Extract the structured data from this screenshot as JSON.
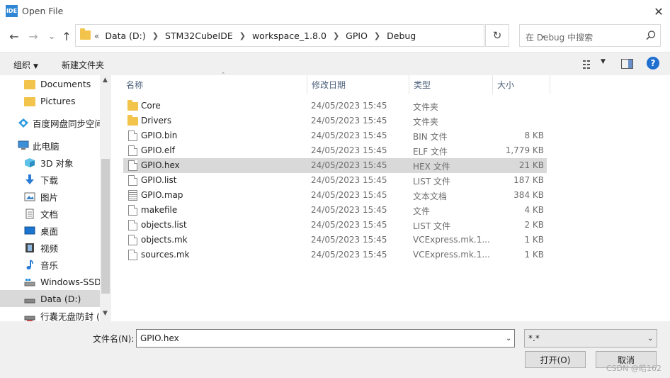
{
  "window": {
    "app_icon": "IDE",
    "title": "Open File",
    "close": "✕"
  },
  "nav": {
    "back": "←",
    "forward": "→",
    "recent": "⌄",
    "up": "↑",
    "breadcrumb": [
      "Data (D:)",
      "STM32CubeIDE",
      "workspace_1.8.0",
      "GPIO",
      "Debug"
    ],
    "overflow": "«",
    "refresh": "↻",
    "search_placeholder": "在 Debug 中搜索"
  },
  "toolbar": {
    "organize": "组织",
    "new_folder": "新建文件夹",
    "help": "?"
  },
  "sidebar": {
    "items": [
      {
        "label": "Documents",
        "icon": "folder-icon"
      },
      {
        "label": "Pictures",
        "icon": "folder-icon"
      },
      {
        "label": "百度网盘同步空间",
        "icon": "baidu-cloud-icon"
      },
      {
        "label": "此电脑",
        "icon": "computer-icon"
      },
      {
        "label": "3D 对象",
        "icon": "cube-3d-icon"
      },
      {
        "label": "下载",
        "icon": "download-icon"
      },
      {
        "label": "图片",
        "icon": "pictures-icon"
      },
      {
        "label": "文档",
        "icon": "documents-icon"
      },
      {
        "label": "桌面",
        "icon": "desktop-icon"
      },
      {
        "label": "视频",
        "icon": "video-icon"
      },
      {
        "label": "音乐",
        "icon": "music-icon"
      },
      {
        "label": "Windows-SSD",
        "icon": "drive-icon"
      },
      {
        "label": "Data (D:)",
        "icon": "drive-icon",
        "selected": true
      },
      {
        "label": "行囊无盘防封 (X",
        "icon": "drive-icon"
      }
    ]
  },
  "columns": {
    "name": "名称",
    "date": "修改日期",
    "type": "类型",
    "size": "大小"
  },
  "files": [
    {
      "name": "Core",
      "date": "24/05/2023 15:45",
      "type": "文件夹",
      "size": "",
      "icon": "folder"
    },
    {
      "name": "Drivers",
      "date": "24/05/2023 15:45",
      "type": "文件夹",
      "size": "",
      "icon": "folder"
    },
    {
      "name": "GPIO.bin",
      "date": "24/05/2023 15:45",
      "type": "BIN 文件",
      "size": "8 KB",
      "icon": "doc"
    },
    {
      "name": "GPIO.elf",
      "date": "24/05/2023 15:45",
      "type": "ELF 文件",
      "size": "1,779 KB",
      "icon": "doc"
    },
    {
      "name": "GPIO.hex",
      "date": "24/05/2023 15:45",
      "type": "HEX 文件",
      "size": "21 KB",
      "icon": "doc",
      "selected": true
    },
    {
      "name": "GPIO.list",
      "date": "24/05/2023 15:45",
      "type": "LIST 文件",
      "size": "187 KB",
      "icon": "doc"
    },
    {
      "name": "GPIO.map",
      "date": "24/05/2023 15:45",
      "type": "文本文档",
      "size": "384 KB",
      "icon": "txt"
    },
    {
      "name": "makefile",
      "date": "24/05/2023 15:45",
      "type": "文件",
      "size": "4 KB",
      "icon": "doc"
    },
    {
      "name": "objects.list",
      "date": "24/05/2023 15:45",
      "type": "LIST 文件",
      "size": "2 KB",
      "icon": "doc"
    },
    {
      "name": "objects.mk",
      "date": "24/05/2023 15:45",
      "type": "VCExpress.mk.1...",
      "size": "1 KB",
      "icon": "doc"
    },
    {
      "name": "sources.mk",
      "date": "24/05/2023 15:45",
      "type": "VCExpress.mk.1...",
      "size": "1 KB",
      "icon": "doc"
    }
  ],
  "footer": {
    "filename_label": "文件名(N):",
    "filename_value": "GPIO.hex",
    "filter": "*.*",
    "open_button": "打开(O)",
    "cancel_button": "取消",
    "watermark": "CSDN @皓162"
  },
  "colors": {
    "selection": "#d9d9d9",
    "folder": "#f3c44c",
    "header_text": "#4c607a",
    "help": "#1e6fd0"
  }
}
